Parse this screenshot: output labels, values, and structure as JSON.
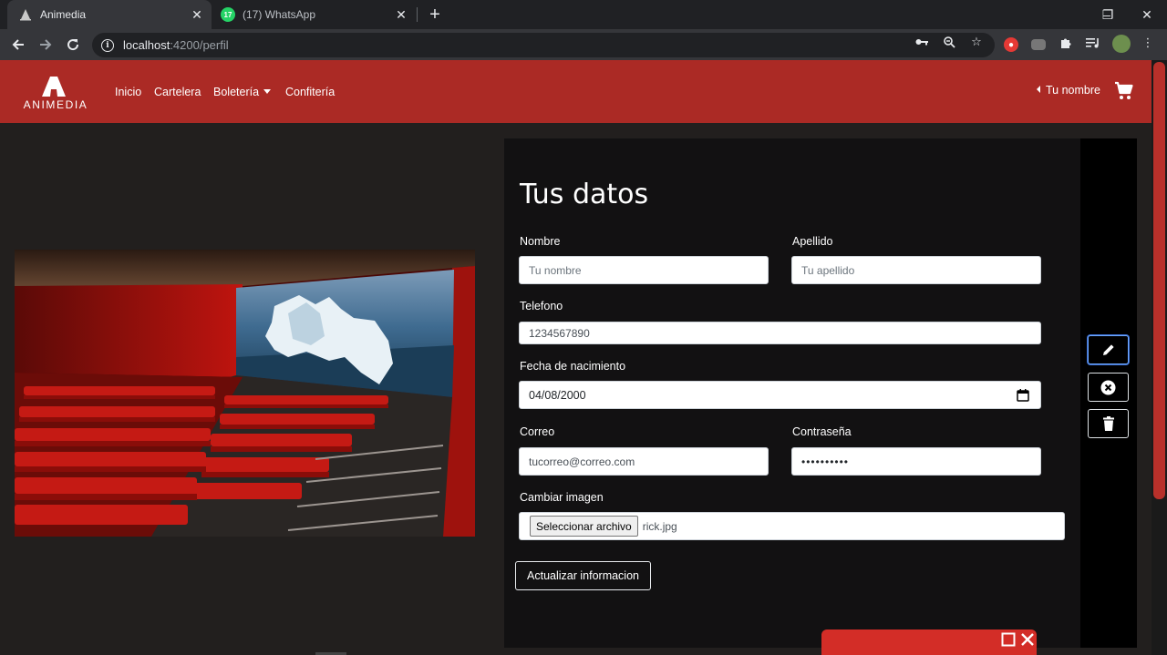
{
  "browser": {
    "tabs": [
      {
        "title": "Animedia",
        "icon": "animedia-favicon"
      },
      {
        "title": "(17) WhatsApp",
        "icon": "whatsapp-favicon",
        "badge": "17"
      }
    ],
    "url_host": "localhost",
    "url_rest": ":4200/perfil",
    "window_controls": {
      "minimize": "–",
      "maximize": "❐",
      "close": "✕"
    }
  },
  "nav": {
    "logo_text": "ANIMEDIA",
    "links": [
      "Inicio",
      "Cartelera",
      "Boletería",
      "Confitería"
    ],
    "user_label": "Tu nombre"
  },
  "form": {
    "title": "Tus datos",
    "nombre_label": "Nombre",
    "nombre_placeholder": "Tu nombre",
    "apellido_label": "Apellido",
    "apellido_placeholder": "Tu apellido",
    "telefono_label": "Telefono",
    "telefono_value": "1234567890",
    "fecha_label": "Fecha de nacimiento",
    "fecha_value": "04/08/2000",
    "correo_label": "Correo",
    "correo_value": "tucorreo@correo.com",
    "contrasena_label": "Contraseña",
    "contrasena_value": "••••••••••",
    "imagen_label": "Cambiar imagen",
    "file_button": "Seleccionar archivo",
    "file_name": "rick.jpg",
    "submit_label": "Actualizar informacion"
  },
  "colors": {
    "navbar": "#ab2a25",
    "page_bg": "#221f1e",
    "panel_bg": "#121112"
  }
}
